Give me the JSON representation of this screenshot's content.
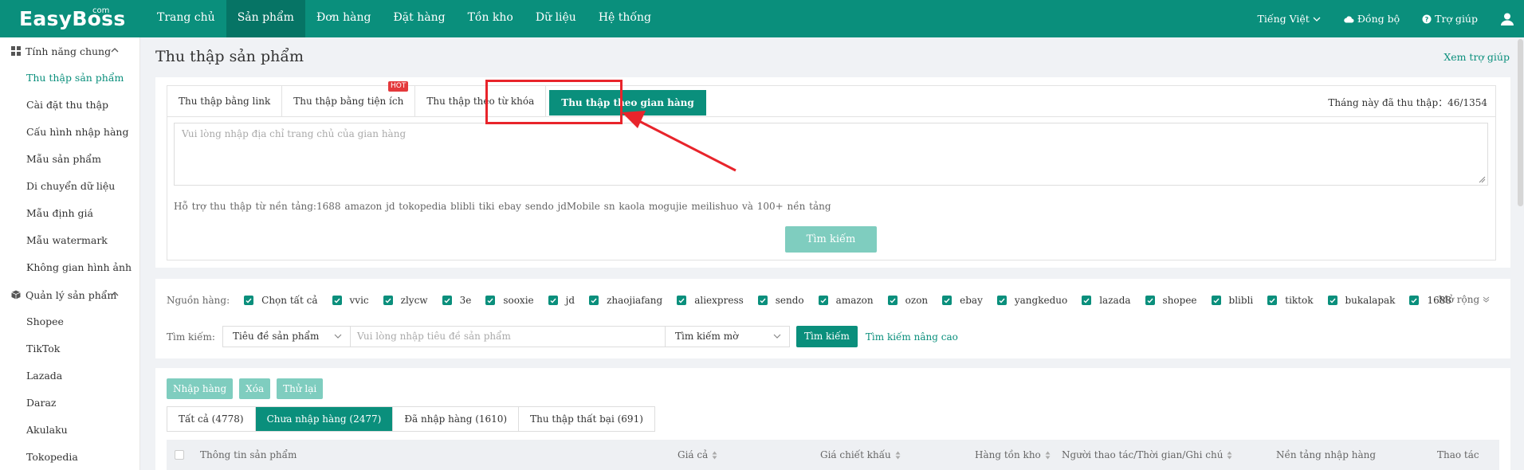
{
  "brand": {
    "name": "EasyBoss",
    "suffix": "com"
  },
  "nav": {
    "items": [
      {
        "label": "Trang chủ"
      },
      {
        "label": "Sản phẩm"
      },
      {
        "label": "Đơn hàng"
      },
      {
        "label": "Đặt hàng"
      },
      {
        "label": "Tồn kho"
      },
      {
        "label": "Dữ liệu"
      },
      {
        "label": "Hệ thống"
      }
    ],
    "active_index": 1,
    "language": "Tiếng Việt",
    "sync": "Đồng bộ",
    "help": "Trợ giúp"
  },
  "sidebar": {
    "group1": {
      "label": "Tính năng chung",
      "icon": "grid-icon"
    },
    "group1_items": [
      {
        "label": "Thu thập sản phẩm",
        "active": true
      },
      {
        "label": "Cài đặt thu thập"
      },
      {
        "label": "Cấu hình nhập hàng"
      },
      {
        "label": "Mẫu sản phẩm"
      },
      {
        "label": "Di chuyển dữ liệu"
      },
      {
        "label": "Mẫu định giá"
      },
      {
        "label": "Mẫu watermark"
      },
      {
        "label": "Không gian hình ảnh"
      }
    ],
    "group2": {
      "label": "Quản lý sản phẩm",
      "icon": "cube-icon"
    },
    "group2_items": [
      {
        "label": "Shopee"
      },
      {
        "label": "TikTok"
      },
      {
        "label": "Lazada"
      },
      {
        "label": "Daraz"
      },
      {
        "label": "Akulaku"
      },
      {
        "label": "Tokopedia"
      }
    ]
  },
  "page": {
    "title": "Thu thập sản phẩm",
    "help_link": "Xem trợ giúp"
  },
  "collect": {
    "tabs": [
      {
        "label": "Thu thập bằng link"
      },
      {
        "label": "Thu thập bằng tiện ích",
        "badge": "HOT"
      },
      {
        "label": "Thu thập theo từ khóa"
      },
      {
        "label": "Thu thập theo gian hàng",
        "active": true
      }
    ],
    "month_count_label": "Tháng này đã thu thập：",
    "month_count_value": "46/1354",
    "textarea_placeholder": "Vui lòng nhập địa chỉ trang chủ của gian hàng",
    "support_text": "Hỗ trợ thu thập từ nền tảng:1688  amazon  jd  tokopedia  blibli  tiki  ebay  sendo  jdMobile  sn  kaola  mogujie  meilishuo và 100+ nền tảng",
    "search_button": "Tìm kiếm"
  },
  "filters": {
    "source_label": "Nguồn hàng:",
    "sources": [
      {
        "label": "Chọn tất cả"
      },
      {
        "label": "vvic"
      },
      {
        "label": "zlycw"
      },
      {
        "label": "3e"
      },
      {
        "label": "sooxie"
      },
      {
        "label": "jd"
      },
      {
        "label": "zhaojiafang"
      },
      {
        "label": "aliexpress"
      },
      {
        "label": "sendo"
      },
      {
        "label": "amazon"
      },
      {
        "label": "ozon"
      },
      {
        "label": "ebay"
      },
      {
        "label": "yangkeduo"
      },
      {
        "label": "lazada"
      },
      {
        "label": "shopee"
      },
      {
        "label": "blibli"
      },
      {
        "label": "tiktok"
      },
      {
        "label": "bukalapak"
      },
      {
        "label": "1688"
      }
    ],
    "expand": "Mở rộng",
    "search_label": "Tìm kiếm:",
    "field_select": "Tiêu đề sản phẩm",
    "search_placeholder": "Vui lòng nhập tiêu đề sản phẩm",
    "mode_select": "Tìm kiếm mờ",
    "search_button": "Tìm kiếm",
    "advanced": "Tìm kiếm nâng cao"
  },
  "list": {
    "actions": [
      {
        "label": "Nhập hàng"
      },
      {
        "label": "Xóa"
      },
      {
        "label": "Thử lại"
      }
    ],
    "tabs": [
      {
        "label": "Tất cả (4778)"
      },
      {
        "label": "Chưa nhập hàng (2477)",
        "active": true
      },
      {
        "label": "Đã nhập hàng (1610)"
      },
      {
        "label": "Thu thập thất bại (691)"
      }
    ],
    "columns": [
      {
        "label": "Thông tin sản phẩm"
      },
      {
        "label": "Giá cả",
        "sortable": true
      },
      {
        "label": "Giá chiết khấu",
        "sortable": true
      },
      {
        "label": "Hàng tồn kho",
        "sortable": true
      },
      {
        "label": "Người thao tác/Thời gian/Ghi chú",
        "sortable": true
      },
      {
        "label": "Nền tảng nhập hàng"
      },
      {
        "label": "Thao tác"
      }
    ]
  },
  "colors": {
    "primary": "#0a8f7c",
    "primary_light": "#7fcdbf",
    "highlight": "#e8242b",
    "hot": "#e4393c"
  }
}
